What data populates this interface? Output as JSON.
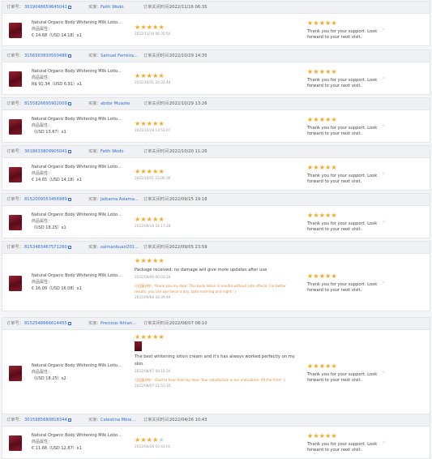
{
  "labels": {
    "order_no": "订单号：",
    "buyer": "买家：",
    "close_time": "订单关闭时间：",
    "product_attr": "商品属性："
  },
  "colors": {
    "star_on": "#f5a623",
    "star_off": "#c9ccd2",
    "link": "#2d6cdf",
    "reply": "#e08a3c"
  },
  "orders": [
    {
      "order_id": "3019048659645041",
      "buyer": "Faith Wodo",
      "close_time": "2022/11/16 06:35",
      "product_name": "Natural Organic Body Whitening Milk Lotio...",
      "product_attr": "商品属性：",
      "price": "€ 14.68（USD 14.18）x1",
      "rating": 5,
      "review_text": "",
      "review_date": "2022/11/16 06:35:54",
      "reply_tag": "",
      "reply_text": "",
      "reply_date": "",
      "has_photo": false,
      "seller_rating": 5,
      "seller_thanks": "Thank you for your support. Look forward to your next visit."
    },
    {
      "order_id": "3156503830550486",
      "buyer": "Samuel Ferreira...",
      "close_time": "2022/10/29 14:35",
      "product_name": "Natural Organic Body Whitening Milk Lotio...",
      "product_attr": "商品属性：",
      "price": "R$ 91.34（USD 6.91）x1",
      "rating": 5,
      "review_text": "",
      "review_date": "2022/10/31 20:32:44",
      "reply_tag": "",
      "reply_text": "",
      "reply_date": "",
      "has_photo": false,
      "seller_rating": 5,
      "seller_thanks": "Thank you for your support. Look forward to your next visit."
    },
    {
      "order_id": "8155826695902009",
      "buyer": "abdor Musoke",
      "close_time": "2022/10/29 13:26",
      "product_name": "Natural Organic Body Whitening Milk Lotio...",
      "product_attr": "商品属性：",
      "price": "（USD 13.67）x1",
      "rating": 5,
      "review_text": "",
      "review_date": "2022/10/29 13:53:07",
      "reply_tag": "",
      "reply_text": "",
      "reply_date": "",
      "has_photo": false,
      "seller_rating": 5,
      "seller_thanks": "Thank you for your support. Look forward to your next visit."
    },
    {
      "order_id": "3018633809905041",
      "buyer": "Faith Wodo",
      "close_time": "2022/10/20 11:26",
      "product_name": "Natural Organic Body Whitening Milk Lotio...",
      "product_attr": "商品属性：",
      "price": "€ 14.65（USD 14.18）x1",
      "rating": 5,
      "review_text": "",
      "review_date": "2022/10/21 15:06:39",
      "reply_tag": "",
      "reply_text": "",
      "reply_date": "",
      "has_photo": false,
      "seller_rating": 5,
      "seller_thanks": "Thank you for your support. Look forward to your next visit."
    },
    {
      "order_id": "8152009553456989",
      "buyer": "Jaibarna Aslama...",
      "close_time": "2022/09/15 19:18",
      "product_name": "Natural Organic Body Whitening Milk Lotio...",
      "product_attr": "商品属性：",
      "price": "（USD 18.25）x1",
      "rating": 5,
      "review_text": "",
      "review_date": "2022/09/16 14:17:28",
      "reply_tag": "",
      "reply_text": "",
      "reply_date": "",
      "has_photo": false,
      "seller_rating": 5,
      "seller_thanks": "Thank you for your support. Look forward to your next visit."
    },
    {
      "order_id": "8153483467571260",
      "buyer": "salmanbuari201...",
      "close_time": "2022/09/05 23:59",
      "product_name": "Natural Organic Body Whitening Milk Lotio...",
      "product_attr": "商品属性：",
      "price": "€ 16.09（USD 16.08）x1",
      "rating": 5,
      "review_text": "Package received, no damage will give more updates after use",
      "review_date": "2022/09/06 00:03:18",
      "reply_tag": "已回复评价：",
      "reply_text": "thank you my dear. This body lotion is mouful without side effects. For better results, you can use twice a day, both morning and night. :)",
      "reply_date": "2022/09/06 18:39:49",
      "has_photo": false,
      "seller_rating": 5,
      "seller_thanks": "Thank you for your support. Look forward to your next visit."
    },
    {
      "order_id": "8152548666614455",
      "buyer": "Precious Ikhian...",
      "close_time": "2022/08/07 08:10",
      "product_name": "Natural Organic Body Whitening Milk Lotio...",
      "product_attr": "商品属性：",
      "price": "（USD 18.25）x2",
      "rating": 5,
      "review_text": "The best whitening lotion cream and it's has always worked perfectly on my skin.",
      "review_date": "2022/08/07 08:16:24",
      "reply_tag": "已回复评价：",
      "reply_text": "Glad to hear that my dear. Your satisfaction is our motivation. All the time! :)",
      "reply_date": "2022/08/07 21:51:35",
      "has_photo": true,
      "seller_rating": 5,
      "seller_thanks": "Thank you for your support. Look forward to your next visit."
    },
    {
      "order_id": "3015985680818344",
      "buyer": "Celestina Mbia ...",
      "close_time": "2022/04/26 10:43",
      "product_name": "Natural Organic Body Whitening Milk Lotio...",
      "product_attr": "商品属性：",
      "price": "€ 11.68（USD 12.87）x1",
      "rating": 4,
      "review_text": "",
      "review_date": "2022/04/26 10:43:01",
      "reply_tag": "",
      "reply_text": "",
      "reply_date": "",
      "has_photo": false,
      "seller_rating": 5,
      "seller_thanks": "Thank you for your support. Look forward to your next visit."
    }
  ]
}
